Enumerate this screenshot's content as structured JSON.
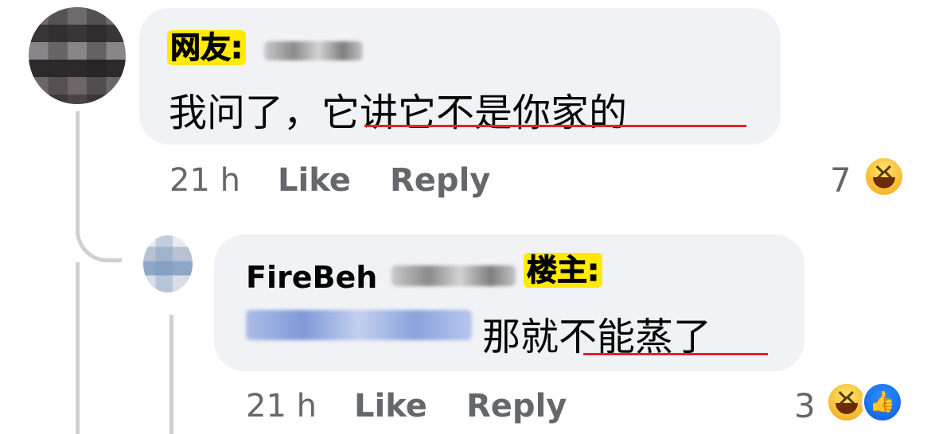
{
  "thread": {
    "comment1": {
      "tag": "网友:",
      "text_prefix": "我问了，",
      "text_highlight": "它讲它不是你家的",
      "time": "21 h",
      "like_label": "Like",
      "reply_label": "Reply",
      "reaction_count": "7",
      "reactions": [
        "haha-icon"
      ]
    },
    "comment2": {
      "author": "FireBeh",
      "tag": "楼主:",
      "text_prefix": "那就",
      "text_highlight": "不能蒸了",
      "time": "21 h",
      "like_label": "Like",
      "reply_label": "Reply",
      "reaction_count": "3",
      "reactions": [
        "haha-icon",
        "like-thumb-icon"
      ]
    }
  },
  "colors": {
    "bubble": "#f0f2f5",
    "meta_text": "#65676b",
    "underline": "#e0242c",
    "tag_highlight": "#ffea00"
  }
}
